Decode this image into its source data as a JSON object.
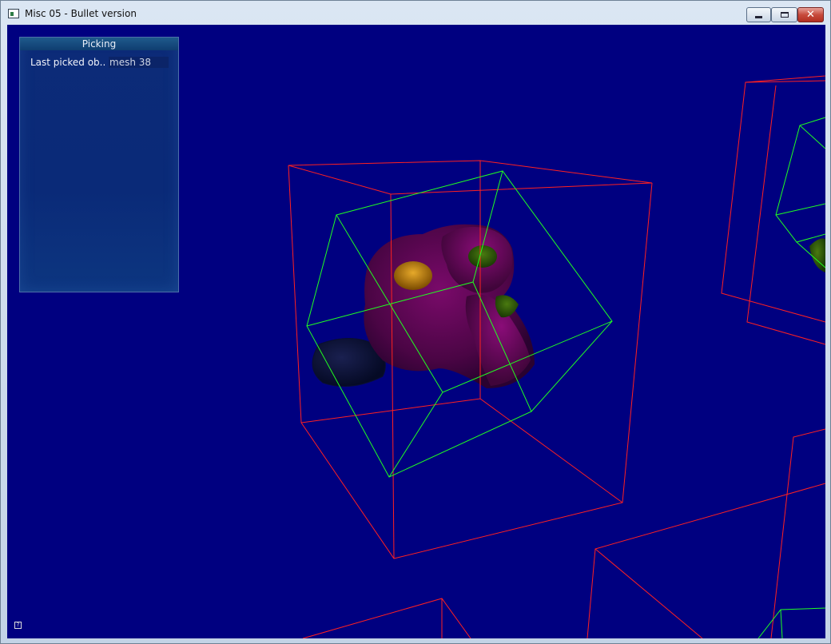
{
  "window": {
    "title": "Misc 05 - Bullet version",
    "close_glyph": "✕"
  },
  "picking_panel": {
    "title": "Picking",
    "row_label": "Last picked ob..",
    "row_value": "mesh 38"
  },
  "help_icon": {
    "glyph": "?"
  },
  "colors": {
    "viewport_background": "#000080",
    "bounding_box_aabb": "#ff2020",
    "bounding_box_obb": "#20ff20",
    "panel_background": "#0a2a78"
  },
  "icons": [
    "app-icon",
    "minimize-icon",
    "maximize-icon",
    "close-icon",
    "help-icon"
  ]
}
